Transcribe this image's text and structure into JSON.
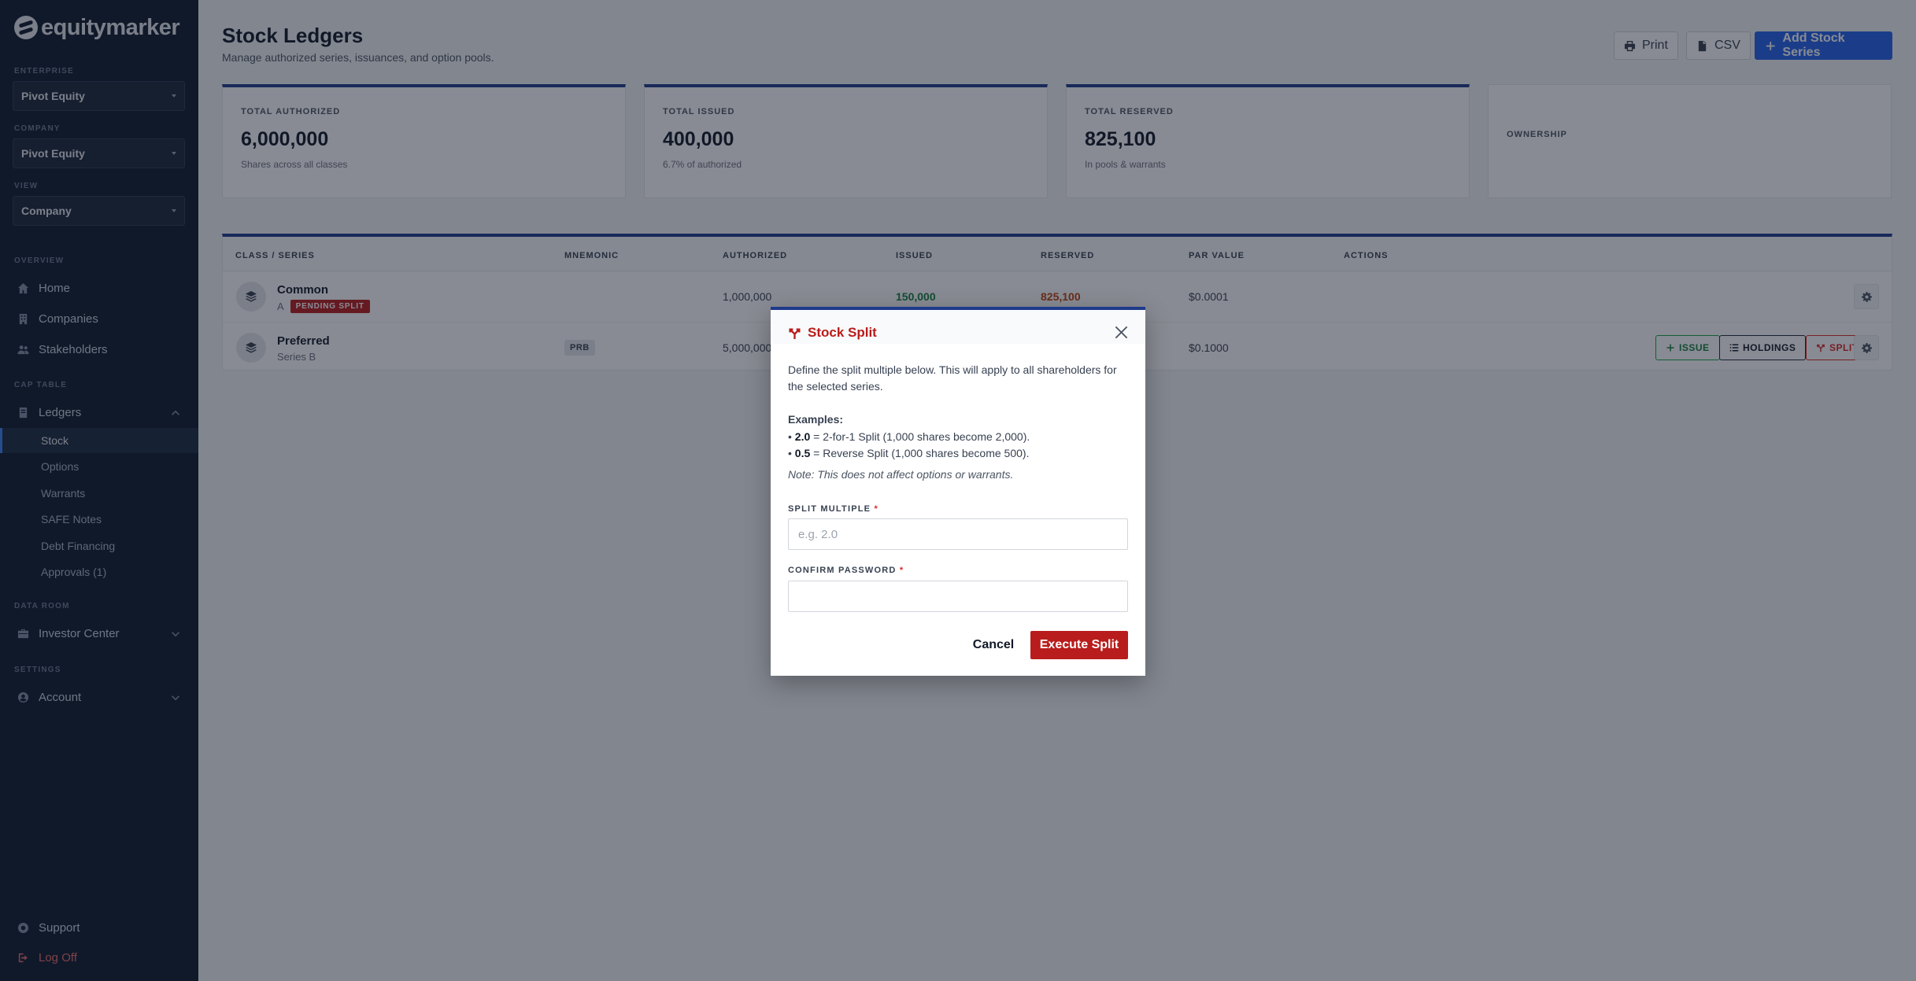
{
  "sidebar": {
    "logo": "equitymarker",
    "enterprise_label": "ENTERPRISE",
    "enterprise_value": "Pivot Equity",
    "company_label": "COMPANY",
    "company_value": "Pivot Equity",
    "view_label": "VIEW",
    "view_value": "Company",
    "overview_label": "OVERVIEW",
    "home": "Home",
    "companies": "Companies",
    "stakeholders": "Stakeholders",
    "cap_table_label": "CAP TABLE",
    "ledgers": "Ledgers",
    "sub": [
      "Stock",
      "Options",
      "Warrants",
      "SAFE Notes",
      "Debt Financing",
      "Approvals (1)"
    ],
    "data_room_label": "DATA ROOM",
    "investor_center": "Investor Center",
    "settings_label": "SETTINGS",
    "account": "Account",
    "support": "Support",
    "log_off": "Log Off"
  },
  "header": {
    "title": "Stock Ledgers",
    "subtitle": "Manage authorized series, issuances, and option pools.",
    "print": "Print",
    "csv": "CSV",
    "add": "Add Stock Series"
  },
  "cards": [
    {
      "label": "TOTAL AUTHORIZED",
      "value": "6,000,000",
      "note": "Shares across all classes"
    },
    {
      "label": "TOTAL ISSUED",
      "value": "400,000",
      "note": "6.7% of authorized"
    },
    {
      "label": "TOTAL RESERVED",
      "value": "825,100",
      "note": "In pools & warrants"
    },
    {
      "label": "OWNERSHIP",
      "value": "",
      "note": ""
    }
  ],
  "table": {
    "headers": [
      "CLASS / SERIES",
      "MNEMONIC",
      "AUTHORIZED",
      "ISSUED",
      "RESERVED",
      "PAR VALUE",
      "ACTIONS"
    ],
    "rows": [
      {
        "name": "Common",
        "sub": "A",
        "badge": "PENDING SPLIT",
        "mnemonic": "",
        "authorized": "1,000,000",
        "issued": "150,000",
        "reserved": "825,100",
        "par": "$0.0001"
      },
      {
        "name": "Preferred",
        "sub": "Series B",
        "badge": "",
        "mnemonic": "PRB",
        "authorized": "5,000,000",
        "issued": "",
        "reserved": "",
        "par": "$0.1000"
      }
    ],
    "actions": {
      "issue": "ISSUE",
      "holdings": "HOLDINGS",
      "split": "SPLIT"
    }
  },
  "modal": {
    "title": "Stock Split",
    "description": "Define the split multiple below. This will apply to all shareholders for the selected series.",
    "examples_title": "Examples:",
    "ex1_value": "2.0",
    "ex1_text": " = 2-for-1 Split (1,000 shares become 2,000).",
    "ex2_value": "0.5",
    "ex2_text": " = Reverse Split (1,000 shares become 500).",
    "note": "Note: This does not affect options or warrants.",
    "multiple_label": "SPLIT MULTIPLE",
    "multiple_placeholder": "e.g. 2.0",
    "multiple_value": "",
    "password_label": "CONFIRM PASSWORD",
    "password_value": "",
    "required_mark": "*",
    "cancel": "Cancel",
    "execute": "Execute Split"
  },
  "colors": {
    "accent": "#2563eb",
    "danger": "#b91c1c",
    "sidebar": "#0f1b2d"
  }
}
